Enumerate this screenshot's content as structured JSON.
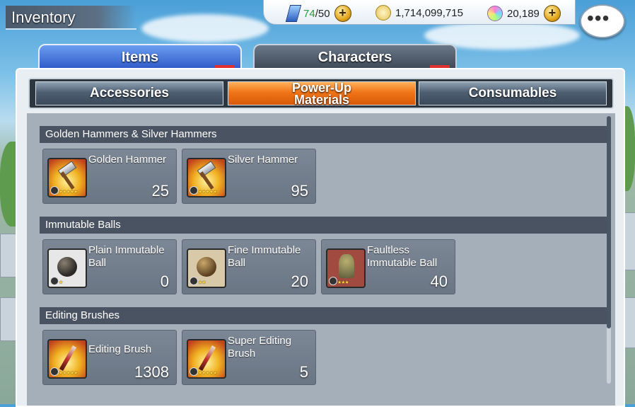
{
  "header": {
    "title": "Inventory",
    "stamina": {
      "current": "74",
      "max": "/50"
    },
    "coins": "1,714,099,715",
    "gems": "20,189",
    "plus_symbol": "+",
    "chat_symbol": "•••"
  },
  "main_tabs": [
    "Items",
    "Characters"
  ],
  "sub_tabs": {
    "accessories": "Accessories",
    "power_up_line1": "Power-Up",
    "power_up_line2": "Materials",
    "consumables": "Consumables"
  },
  "sections": [
    {
      "title": "Golden Hammers & Silver Hammers",
      "items": [
        {
          "name": "Golden Hammer",
          "count": "25",
          "stars": "★★★★★",
          "icon": "golden-hammer-icon"
        },
        {
          "name": "Silver Hammer",
          "count": "95",
          "stars": "★★★★★",
          "icon": "silver-hammer-icon"
        }
      ]
    },
    {
      "title": "Immutable Balls",
      "items": [
        {
          "name": "Plain Immutable Ball",
          "count": "0",
          "stars": "★",
          "icon": "plain-immutable-ball-icon"
        },
        {
          "name": "Fine Immutable Ball",
          "count": "20",
          "stars": "★★",
          "icon": "fine-immutable-ball-icon"
        },
        {
          "name": "Faultless Immutable Ball",
          "count": "40",
          "stars": "★★★",
          "icon": "faultless-immutable-ball-icon"
        }
      ]
    },
    {
      "title": "Editing Brushes",
      "items": [
        {
          "name": "Editing Brush",
          "count": "1308",
          "stars": "★★★★★",
          "icon": "editing-brush-icon"
        },
        {
          "name": "Super Editing Brush",
          "count": "5",
          "stars": "★★★★★",
          "icon": "super-editing-brush-icon"
        }
      ]
    }
  ],
  "colors": {
    "active_subtab": "#f07418",
    "items_tab": "#2e58c8",
    "stamina_current": "#2a9a3a"
  }
}
